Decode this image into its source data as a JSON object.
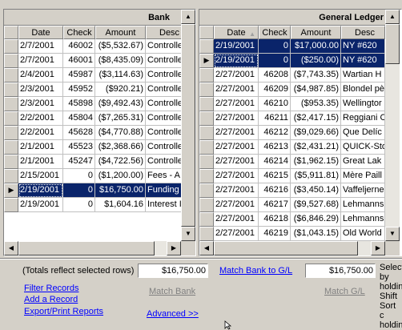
{
  "bank": {
    "title": "Bank",
    "columns": [
      "Date",
      "Check",
      "Amount",
      "Desc"
    ],
    "rows": [
      {
        "date": "2/7/2001",
        "check": "46002",
        "amount": "($5,532.67)",
        "desc": "Controlle"
      },
      {
        "date": "2/7/2001",
        "check": "46001",
        "amount": "($8,435.09)",
        "desc": "Controlle"
      },
      {
        "date": "2/4/2001",
        "check": "45987",
        "amount": "($3,114.63)",
        "desc": "Controlle"
      },
      {
        "date": "2/3/2001",
        "check": "45952",
        "amount": "($920.21)",
        "desc": "Controlle"
      },
      {
        "date": "2/3/2001",
        "check": "45898",
        "amount": "($9,492.43)",
        "desc": "Controlle"
      },
      {
        "date": "2/2/2001",
        "check": "45804",
        "amount": "($7,265.31)",
        "desc": "Controlle"
      },
      {
        "date": "2/2/2001",
        "check": "45628",
        "amount": "($4,770.88)",
        "desc": "Controlle"
      },
      {
        "date": "2/1/2001",
        "check": "45523",
        "amount": "($2,368.66)",
        "desc": "Controlle"
      },
      {
        "date": "2/1/2001",
        "check": "45247",
        "amount": "($4,722.56)",
        "desc": "Controlle"
      },
      {
        "date": "2/15/2001",
        "check": "0",
        "amount": "($1,200.00)",
        "desc": "Fees - A"
      },
      {
        "date": "2/19/2001",
        "check": "0",
        "amount": "$16,750.00",
        "desc": "Funding"
      },
      {
        "date": "2/19/2001",
        "check": "0",
        "amount": "$1,604.16",
        "desc": "Interest I"
      }
    ]
  },
  "ledger": {
    "title": "General Ledger",
    "columns": [
      "Date",
      "Check",
      "Amount",
      "Desc"
    ],
    "rows": [
      {
        "date": "2/19/2001",
        "check": "0",
        "amount": "$17,000.00",
        "desc": "NY #620"
      },
      {
        "date": "2/19/2001",
        "check": "0",
        "amount": "($250.00)",
        "desc": "NY #620"
      },
      {
        "date": "2/27/2001",
        "check": "46208",
        "amount": "($7,743.35)",
        "desc": "Wartian H"
      },
      {
        "date": "2/27/2001",
        "check": "46209",
        "amount": "($4,987.85)",
        "desc": "Blondel pè"
      },
      {
        "date": "2/27/2001",
        "check": "46210",
        "amount": "($953.35)",
        "desc": "Wellingtor"
      },
      {
        "date": "2/27/2001",
        "check": "46211",
        "amount": "($2,417.15)",
        "desc": "Reggiani C"
      },
      {
        "date": "2/27/2001",
        "check": "46212",
        "amount": "($9,029.66)",
        "desc": "Que Delíc"
      },
      {
        "date": "2/27/2001",
        "check": "46213",
        "amount": "($2,431.21)",
        "desc": "QUICK-Sto"
      },
      {
        "date": "2/27/2001",
        "check": "46214",
        "amount": "($1,962.15)",
        "desc": "Great Lak"
      },
      {
        "date": "2/27/2001",
        "check": "46215",
        "amount": "($5,911.81)",
        "desc": "Mère Paill"
      },
      {
        "date": "2/27/2001",
        "check": "46216",
        "amount": "($3,450.14)",
        "desc": "Vaffeljerne"
      },
      {
        "date": "2/27/2001",
        "check": "46217",
        "amount": "($9,527.68)",
        "desc": "Lehmanns"
      },
      {
        "date": "2/27/2001",
        "check": "46218",
        "amount": "($6,846.29)",
        "desc": "Lehmanns"
      },
      {
        "date": "2/27/2001",
        "check": "46219",
        "amount": "($1,043.15)",
        "desc": "Old World"
      }
    ]
  },
  "footer": {
    "totals_label": "(Totals reflect selected rows)",
    "bank_total": "$16,750.00",
    "gl_total": "$16,750.00",
    "match_bank_to_gl": "Match Bank to G/L",
    "match_bank": "Match Bank",
    "match_gl": "Match G/L",
    "filter_records": "Filter Records",
    "add_record": "Add a Record",
    "export_print": "Export/Print Reports",
    "advanced": "Advanced >>",
    "side_note": "Select by holding Shift Sort c holdin"
  }
}
